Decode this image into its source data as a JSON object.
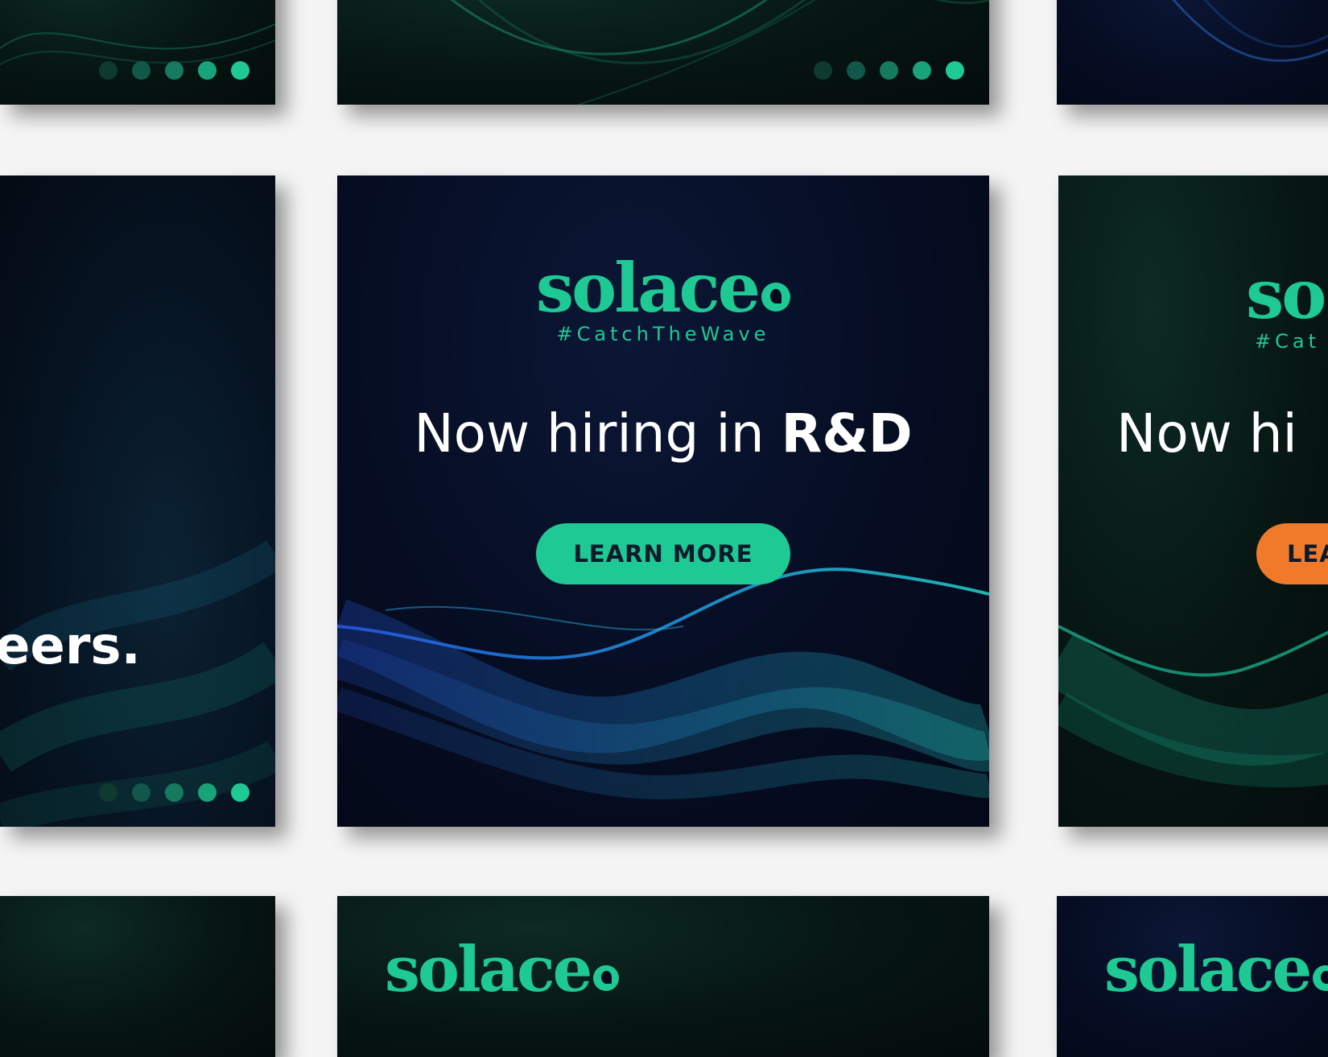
{
  "colors": {
    "brand_green": "#1ec994",
    "cta_orange": "#f07a2a",
    "text_white": "#ffffff"
  },
  "brand": {
    "name": "solace",
    "tagline": "#CatchTheWave"
  },
  "featured_ad": {
    "headline_prefix": "Now hiring in ",
    "headline_bold": "R&D",
    "cta_label": "LEARN MORE"
  },
  "right_ad": {
    "logo_partial": "so",
    "tagline_partial": "#Cat",
    "headline_partial": "Now hi",
    "cta_partial": "LEA"
  },
  "left_ad": {
    "headline_partial": "eers."
  },
  "bottom_ads": {
    "center_logo": "solace",
    "right_logo": "solace"
  },
  "carousel": {
    "dot_count": 5,
    "active_index": 4
  }
}
